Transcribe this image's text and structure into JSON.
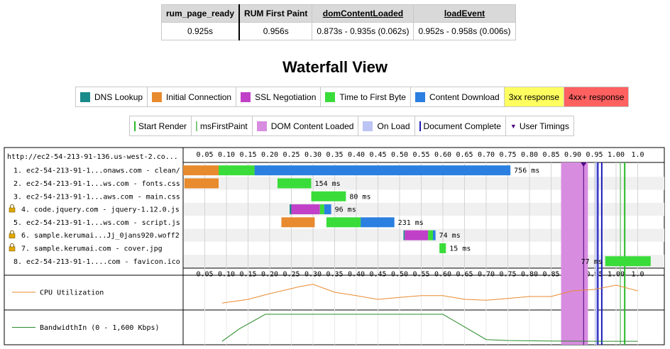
{
  "metrics": {
    "headers": [
      "rum_page_ready",
      "RUM First Paint",
      "domContentLoaded",
      "loadEvent"
    ],
    "values": [
      "0.925s",
      "0.956s",
      "0.873s - 0.935s (0.062s)",
      "0.952s - 0.958s (0.006s)"
    ]
  },
  "waterfall_title": "Waterfall View",
  "legend_types": [
    {
      "label": "DNS Lookup",
      "color": "#1b8a8a",
      "style": "swatch"
    },
    {
      "label": "Initial Connection",
      "color": "#e88a2e",
      "style": "swatch"
    },
    {
      "label": "SSL Negotiation",
      "color": "#c040c8",
      "style": "swatch"
    },
    {
      "label": "Time to First Byte",
      "color": "#3adc3a",
      "style": "swatch"
    },
    {
      "label": "Content Download",
      "color": "#2a7fe0",
      "style": "swatch"
    },
    {
      "label": "3xx response",
      "color": "#ffff60",
      "style": "box"
    },
    {
      "label": "4xx+ response",
      "color": "#ff6060",
      "style": "box"
    }
  ],
  "legend_events": [
    {
      "label": "Start Render",
      "color": "#28b828",
      "style": "line"
    },
    {
      "label": "msFirstPaint",
      "color": "#7fc87f",
      "style": "line"
    },
    {
      "label": "DOM Content Loaded",
      "color": "#d88ce0",
      "style": "swatch"
    },
    {
      "label": "On Load",
      "color": "#bcc4f4",
      "style": "swatch"
    },
    {
      "label": "Document Complete",
      "color": "#1a1ab8",
      "style": "line"
    },
    {
      "label": "User Timings",
      "color": "#4b0082",
      "style": "triangle"
    }
  ],
  "waterfall": {
    "page_url": "http://ec2-54-213-91-136.us-west-2.co...",
    "ticks": [
      "0.05",
      "0.10",
      "0.15",
      "0.20",
      "0.25",
      "0.30",
      "0.35",
      "0.40",
      "0.45",
      "0.50",
      "0.55",
      "0.60",
      "0.65",
      "0.70",
      "0.75",
      "0.80",
      "0.85",
      "0.90",
      "0.95",
      "1.00",
      "1.0"
    ],
    "requests": [
      {
        "label": "1. ec2-54-213-91-1...onaws.com - clean/",
        "lock": false,
        "duration": "756 ms",
        "phases": [
          {
            "type": "connect",
            "start": 0.0,
            "end": 0.082
          },
          {
            "type": "ttfb",
            "start": 0.082,
            "end": 0.165
          },
          {
            "type": "download",
            "start": 0.165,
            "end": 0.756
          }
        ]
      },
      {
        "label": "2. ec2-54-213-91-1...ws.com - fonts.css",
        "lock": false,
        "duration": "154 ms",
        "phases": [
          {
            "type": "connect",
            "start": 0.003,
            "end": 0.082
          },
          {
            "type": "ttfb",
            "start": 0.218,
            "end": 0.296
          }
        ]
      },
      {
        "label": "3. ec2-54-213-91-1...aws.com - main.css",
        "lock": false,
        "duration": "80 ms",
        "phases": [
          {
            "type": "ttfb",
            "start": 0.296,
            "end": 0.376
          }
        ]
      },
      {
        "label": "4. code.jquery.com - jquery-1.12.0.js",
        "lock": true,
        "duration": "96 ms",
        "phases": [
          {
            "type": "dns",
            "start": 0.246,
            "end": 0.25
          },
          {
            "type": "ssl",
            "start": 0.25,
            "end": 0.316
          },
          {
            "type": "ttfb",
            "start": 0.316,
            "end": 0.326
          },
          {
            "type": "download",
            "start": 0.326,
            "end": 0.342
          }
        ]
      },
      {
        "label": "5. ec2-54-213-91-1...ws.com - script.js",
        "lock": false,
        "duration": "231 ms",
        "phases": [
          {
            "type": "connect",
            "start": 0.227,
            "end": 0.304
          },
          {
            "type": "ttfb",
            "start": 0.331,
            "end": 0.41
          },
          {
            "type": "download",
            "start": 0.41,
            "end": 0.488
          }
        ]
      },
      {
        "label": "6. sample.kerumai...Jj_0jans920.woff2",
        "lock": true,
        "duration": "74 ms",
        "phases": [
          {
            "type": "dns",
            "start": 0.509,
            "end": 0.512
          },
          {
            "type": "ssl",
            "start": 0.512,
            "end": 0.566
          },
          {
            "type": "ttfb",
            "start": 0.566,
            "end": 0.577
          },
          {
            "type": "download",
            "start": 0.577,
            "end": 0.583
          }
        ]
      },
      {
        "label": "7. sample.kerumai.com - cover.jpg",
        "lock": true,
        "duration": "15 ms",
        "phases": [
          {
            "type": "ttfb",
            "start": 0.592,
            "end": 0.607
          }
        ]
      },
      {
        "label": "8. ec2-54-213-91-1....com - favicon.ico",
        "lock": false,
        "duration": "77 ms",
        "phases": [
          {
            "type": "ttfb",
            "start": 0.975,
            "end": 1.08
          }
        ]
      }
    ],
    "events": {
      "dom_content_loaded": [
        0.873,
        0.935
      ],
      "on_load": [
        0.952,
        0.958
      ],
      "start_render": 1.02,
      "ms_first_paint": 1.01,
      "document_complete": [
        0.958,
        0.967
      ],
      "user_timing": 0.925
    }
  },
  "cpu": {
    "label": "CPU Utilization",
    "color": "#e88a2e",
    "points": [
      [
        0.09,
        0.12
      ],
      [
        0.15,
        0.25
      ],
      [
        0.2,
        0.45
      ],
      [
        0.27,
        0.7
      ],
      [
        0.3,
        0.78
      ],
      [
        0.35,
        0.5
      ],
      [
        0.4,
        0.38
      ],
      [
        0.45,
        0.25
      ],
      [
        0.5,
        0.32
      ],
      [
        0.55,
        0.38
      ],
      [
        0.6,
        0.38
      ],
      [
        0.65,
        0.25
      ],
      [
        0.7,
        0.22
      ],
      [
        0.75,
        0.28
      ],
      [
        0.8,
        0.35
      ],
      [
        0.85,
        0.35
      ],
      [
        0.9,
        0.55
      ],
      [
        0.95,
        0.6
      ],
      [
        1.0,
        0.75
      ],
      [
        1.05,
        0.55
      ]
    ]
  },
  "bandwidth": {
    "label": "BandwidthIn (0 - 1,600 Kbps)",
    "color": "#2a8a2a",
    "points": [
      [
        0.09,
        0.02
      ],
      [
        0.13,
        0.45
      ],
      [
        0.19,
        0.95
      ],
      [
        0.25,
        0.95
      ],
      [
        0.3,
        0.95
      ],
      [
        0.4,
        0.95
      ],
      [
        0.5,
        0.95
      ],
      [
        0.6,
        0.95
      ],
      [
        0.7,
        0.08
      ],
      [
        0.75,
        0.05
      ],
      [
        0.85,
        0.03
      ],
      [
        0.95,
        0.02
      ],
      [
        1.05,
        0.02
      ]
    ]
  }
}
